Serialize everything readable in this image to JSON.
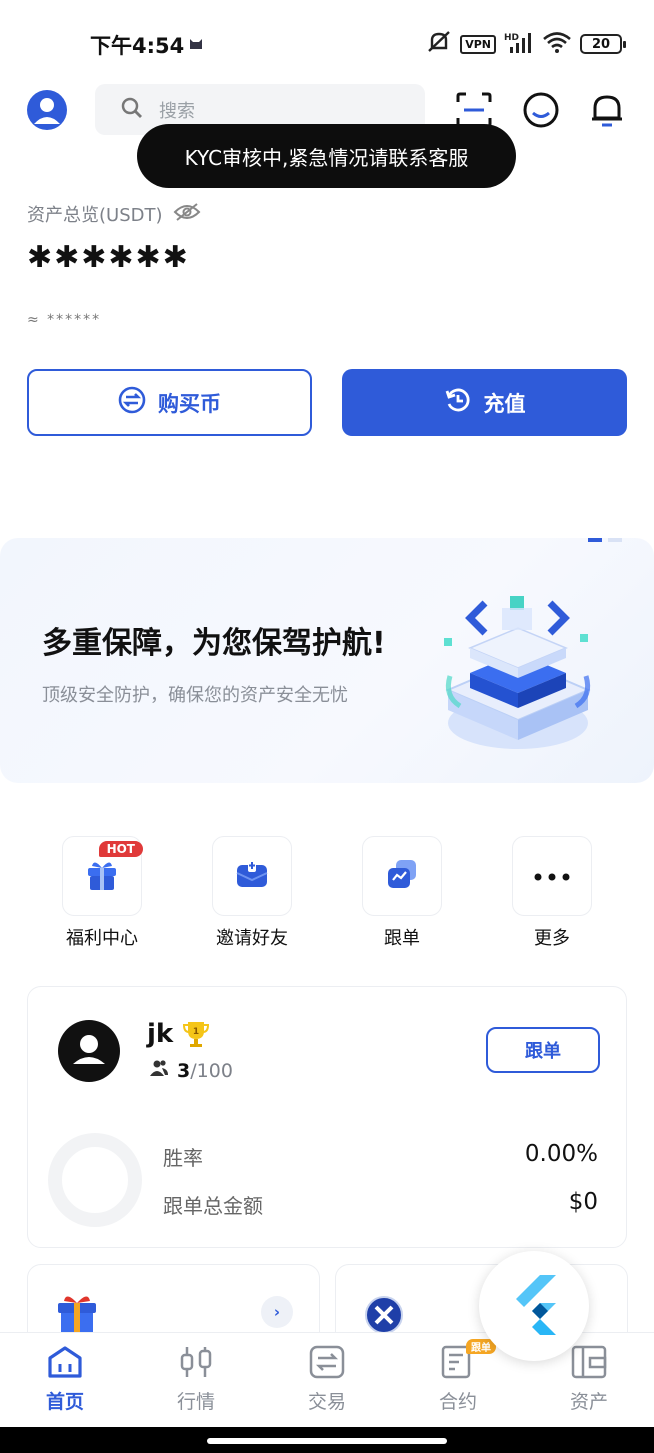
{
  "status_bar": {
    "time": "下午4:54",
    "vpn": "VPN",
    "network": "HD",
    "battery": "20"
  },
  "header": {
    "search_placeholder": "搜索"
  },
  "toast": {
    "message": "KYC审核中,紧急情况请联系客服"
  },
  "assets": {
    "label": "资产总览(USDT)",
    "value_masked": "✱✱✱✱✱✱",
    "approx_masked": "≈ ******",
    "buy_label": "购买币",
    "deposit_label": "充值"
  },
  "banner": {
    "title": "多重保障，为您保驾护航!",
    "subtitle": "顶级安全防护，确保您的资产安全无忧"
  },
  "quick_actions": [
    {
      "label": "福利中心",
      "badge": "HOT"
    },
    {
      "label": "邀请好友"
    },
    {
      "label": "跟单"
    },
    {
      "label": "更多"
    }
  ],
  "trader": {
    "name": "jk",
    "followers": "3",
    "followers_max": "/100",
    "follow_label": "跟单",
    "stats": [
      {
        "label": "胜率",
        "value": "0.00%"
      },
      {
        "label": "跟单总金额",
        "value": "$0"
      }
    ]
  },
  "tabs": [
    {
      "label": "首页",
      "active": true
    },
    {
      "label": "行情"
    },
    {
      "label": "交易"
    },
    {
      "label": "合约",
      "badge": "跟单"
    },
    {
      "label": "资产"
    }
  ],
  "colors": {
    "accent": "#2f5bd9",
    "hot": "#e03a3a",
    "badge": "#f5a623"
  }
}
